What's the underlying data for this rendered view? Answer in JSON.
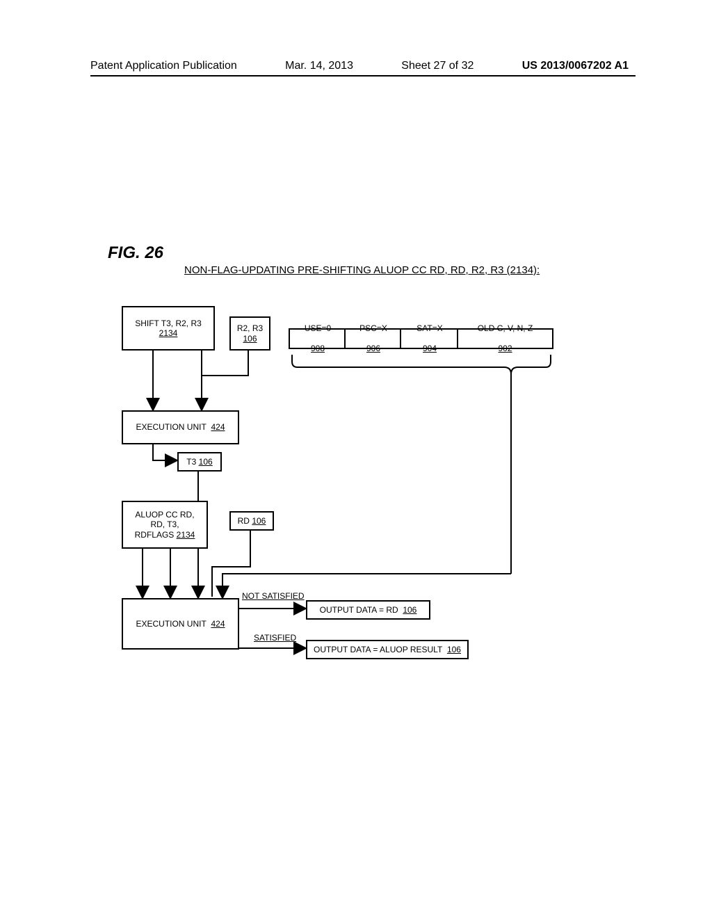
{
  "header": {
    "publication": "Patent Application Publication",
    "date": "Mar. 14, 2013",
    "sheet": "Sheet 27 of 32",
    "pubnum": "US 2013/0067202 A1"
  },
  "figure": {
    "label": "FIG. 26",
    "subtitle": "NON-FLAG-UPDATING PRE-SHIFTING ALUOP CC RD, RD, R2, R3 (2134):"
  },
  "boxes": {
    "shift": {
      "line1": "SHIFT T3, R2, R3",
      "ref": "2134"
    },
    "r2r3": {
      "line1": "R2, R3",
      "ref": "106"
    },
    "use": {
      "text": "USE=0",
      "ref": "908"
    },
    "psc": {
      "text": "PSC=X",
      "ref": "906"
    },
    "sat": {
      "text": "SAT=X",
      "ref": "904"
    },
    "old": {
      "text": "OLD C, V, N, Z",
      "ref": "902"
    },
    "exec1": {
      "text": "EXECUTION UNIT",
      "ref": "424"
    },
    "t3": {
      "text": "T3",
      "ref": "106"
    },
    "aluop": {
      "line1": "ALUOP CC RD,",
      "line2": "RD, T3,",
      "line3": "RDFLAGS",
      "ref": "2134"
    },
    "rd": {
      "text": "RD",
      "ref": "106"
    },
    "exec2": {
      "text": "EXECUTION UNIT",
      "ref": "424"
    },
    "out1": {
      "text": "OUTPUT DATA = RD",
      "ref": "106"
    },
    "out2": {
      "text": "OUTPUT DATA = ALUOP RESULT",
      "ref": "106"
    }
  },
  "labels": {
    "not_satisfied": "NOT SATISFIED",
    "satisfied": "SATISFIED"
  }
}
